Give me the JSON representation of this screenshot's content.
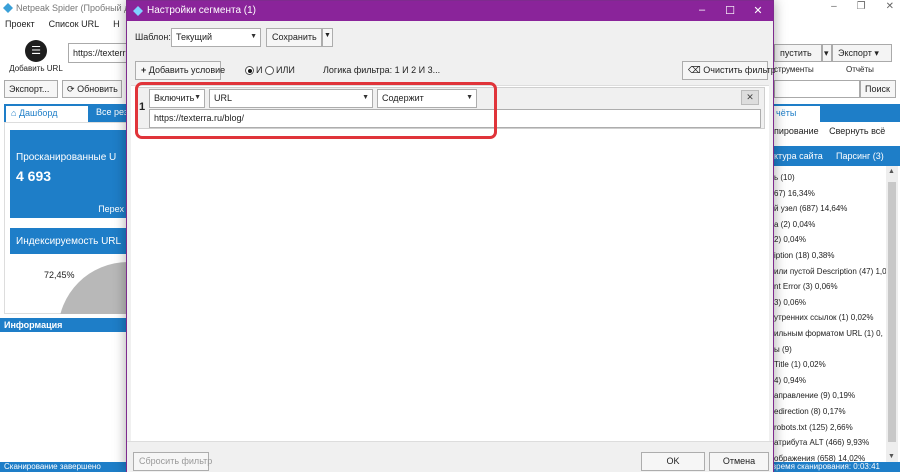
{
  "app": {
    "title": "Netpeak Spider (Пробный дост",
    "window_buttons": [
      "–",
      "❐",
      "✕"
    ],
    "menu": [
      "Проект",
      "Список URL",
      "Н"
    ],
    "add_url_label": "Добавить URL",
    "url_value": "https://texterr",
    "btn_export": "Экспорт...",
    "btn_refresh": "Обновить",
    "btn_start": "пустить",
    "btn_export2": "Экспорт",
    "lbl_tools": "струменты",
    "lbl_reports": "Отчёты",
    "btn_search": "Поиск",
    "tab_dashboard": "Дашборд",
    "tab_all": "Все рез",
    "stat_label": "Просканированные U",
    "stat_value": "4 693",
    "stat_more": "Перех",
    "index_label": "Индексируемость URL",
    "pie_pct": "72,45%",
    "info_label": "Информация",
    "status_left": "Сканирование завершено",
    "status_right": "время сканирования: 0:03:41",
    "right_tab": "чёты",
    "right_tools_1": "пирование",
    "right_tools_2": "Свернуть всё",
    "right_tabs_1": "ктура сайта",
    "right_tabs_2": "Парсинг (3)",
    "right_list": [
      "ь (10)",
      "67) 16,34%",
      "й узел (687) 14,64%",
      "а (2) 0,04%",
      "2) 0,04%",
      "iption (18) 0,38%",
      "или пустой Description (47) 1,0",
      "nt Error (3) 0,06%",
      "3) 0,06%",
      "утренних ссылок (1) 0,02%",
      "ильным форматом URL (1) 0,",
      "ы (9)",
      "Title (1) 0,02%",
      "4) 0,94%",
      "аправление (9) 0,19%",
      "edirection (8) 0,17%",
      "robots.txt (125) 2,66%",
      "атрибута ALT (466) 9,93%",
      "ображения (658) 14,02%"
    ]
  },
  "dialog": {
    "title": "Настройки сегмента (1)",
    "template_label": "Шаблон:",
    "template_value": "Текущий",
    "save_label": "Сохранить",
    "add_condition_label": "Добавить условие",
    "logic_and": "И",
    "logic_or": "ИЛИ",
    "logic_label": "Логика фильтра: 1 И 2 И 3...",
    "clear_filter_label": "Очистить фильтр",
    "condition": {
      "number": "1",
      "mode": "Включить",
      "field": "URL",
      "operator": "Содержит",
      "value": "https://texterra.ru/blog/",
      "remove": "✕"
    },
    "reset_label": "Сбросить фильтр",
    "ok_label": "OK",
    "cancel_label": "Отмена"
  }
}
